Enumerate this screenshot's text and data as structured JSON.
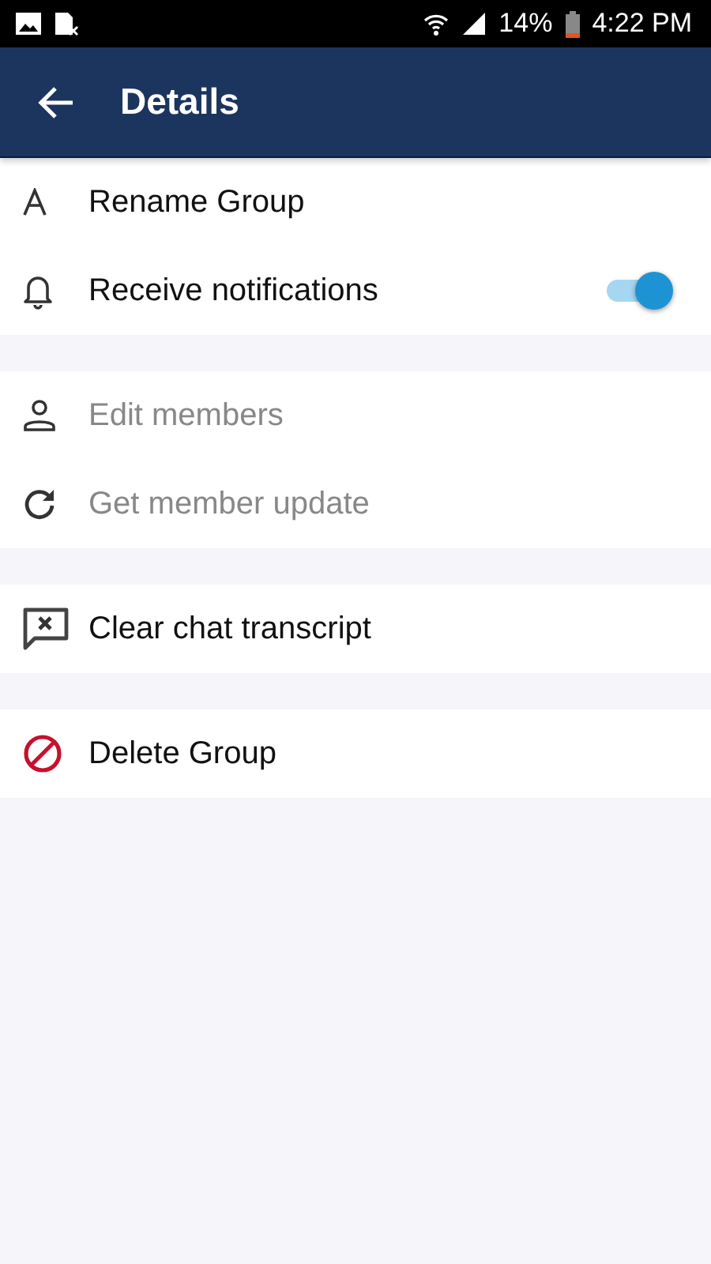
{
  "status_bar": {
    "battery": "14%",
    "time": "4:22 PM"
  },
  "app_bar": {
    "title": "Details"
  },
  "sections": [
    {
      "items": [
        {
          "label": "Rename Group",
          "kind": "action",
          "disabled": false
        },
        {
          "label": "Receive notifications",
          "kind": "toggle",
          "disabled": false,
          "on": true
        }
      ]
    },
    {
      "items": [
        {
          "label": "Edit members",
          "kind": "action",
          "disabled": true
        },
        {
          "label": "Get member update",
          "kind": "action",
          "disabled": true
        }
      ]
    },
    {
      "items": [
        {
          "label": "Clear chat transcript",
          "kind": "action",
          "disabled": false
        }
      ]
    },
    {
      "items": [
        {
          "label": "Delete Group",
          "kind": "action",
          "disabled": false
        }
      ]
    }
  ]
}
